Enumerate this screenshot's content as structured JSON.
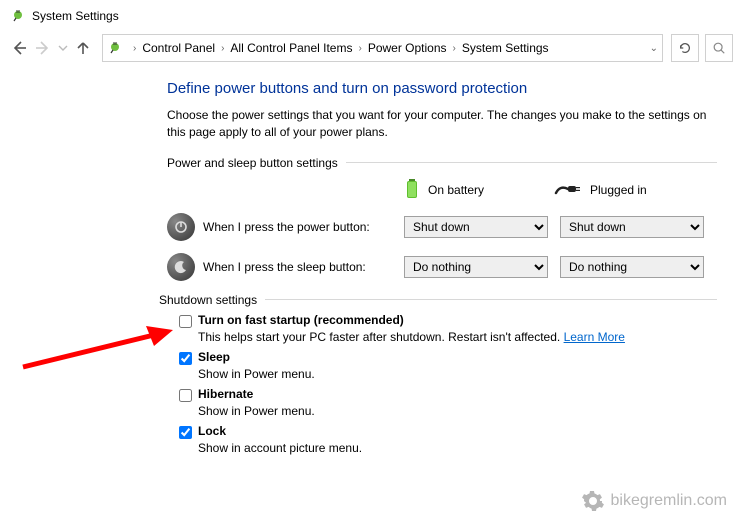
{
  "window": {
    "title": "System Settings"
  },
  "breadcrumb": {
    "items": [
      "Control Panel",
      "All Control Panel Items",
      "Power Options",
      "System Settings"
    ]
  },
  "main": {
    "heading": "Define power buttons and turn on password protection",
    "subhead": "Choose the power settings that you want for your computer. The changes you make to the settings on this page apply to all of your power plans.",
    "group1_label": "Power and sleep button settings",
    "col_battery": "On battery",
    "col_plugged": "Plugged in",
    "row_power_label": "When I press the power button:",
    "row_power_battery": "Shut down",
    "row_power_plugged": "Shut down",
    "row_sleep_label": "When I press the sleep button:",
    "row_sleep_battery": "Do nothing",
    "row_sleep_plugged": "Do nothing",
    "group2_label": "Shutdown settings",
    "fast_startup": {
      "label": "Turn on fast startup (recommended)",
      "desc_prefix": "This helps start your PC faster after shutdown. Restart isn't affected. ",
      "learn": "Learn More",
      "checked": false
    },
    "sleep": {
      "label": "Sleep",
      "desc": "Show in Power menu.",
      "checked": true
    },
    "hibernate": {
      "label": "Hibernate",
      "desc": "Show in Power menu.",
      "checked": false
    },
    "lock": {
      "label": "Lock",
      "desc": "Show in account picture menu.",
      "checked": true
    }
  },
  "watermark": "bikegremlin.com"
}
